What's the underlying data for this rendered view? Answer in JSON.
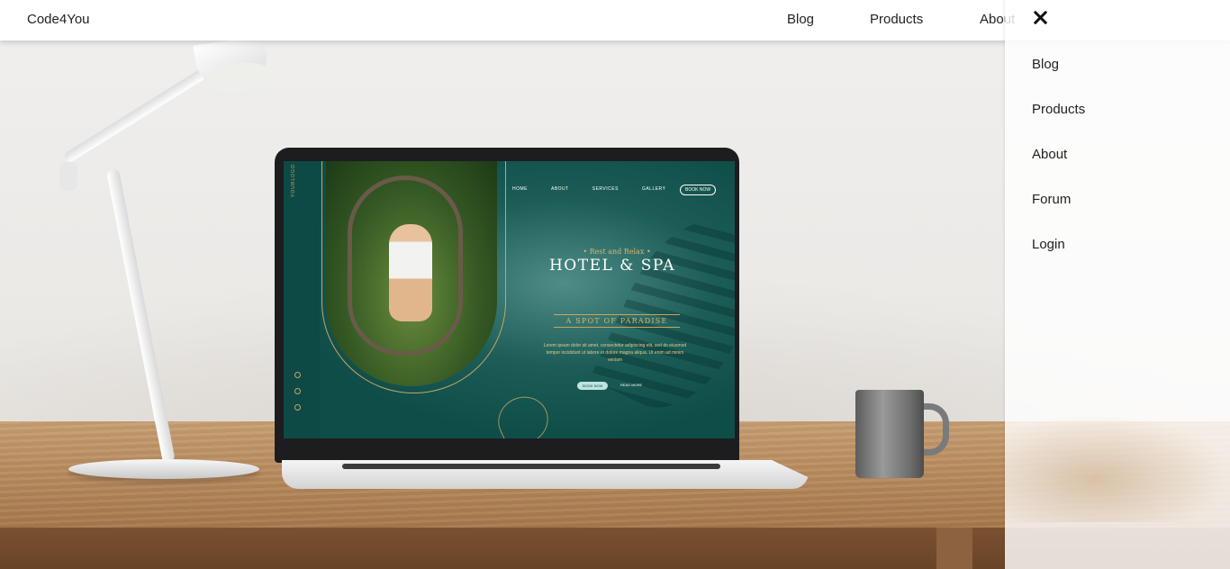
{
  "navbar": {
    "brand": "Code4You",
    "links": [
      "Blog",
      "Products",
      "About"
    ]
  },
  "sidebar": {
    "close_icon": "close-icon",
    "items": [
      {
        "label": "Blog"
      },
      {
        "label": "Products"
      },
      {
        "label": "About"
      },
      {
        "label": "Forum"
      },
      {
        "label": "Login"
      }
    ]
  },
  "hero": {
    "screen": {
      "vertical_text": "YOURLOGO",
      "nav": [
        "HOME",
        "ABOUT",
        "SERVICES",
        "GALLERY"
      ],
      "nav_button": "BOOK NOW",
      "tagline": "• Rest and Relax •",
      "title": "HOTEL & SPA",
      "subtitle": "A SPOT OF PARADISE",
      "paragraph": "Lorem ipsum dolor sit amet, consectetur adipiscing elit, sed do eiusmod tempor incididunt ut labore et dolore magna aliqua. Ut enim ad minim veniam",
      "cta_primary": "BOOK NOW",
      "cta_secondary": "READ MORE"
    }
  },
  "colors": {
    "screen_teal": "#0f4d48",
    "gold": "#caa560",
    "desk_wood": "#b98c5f"
  }
}
